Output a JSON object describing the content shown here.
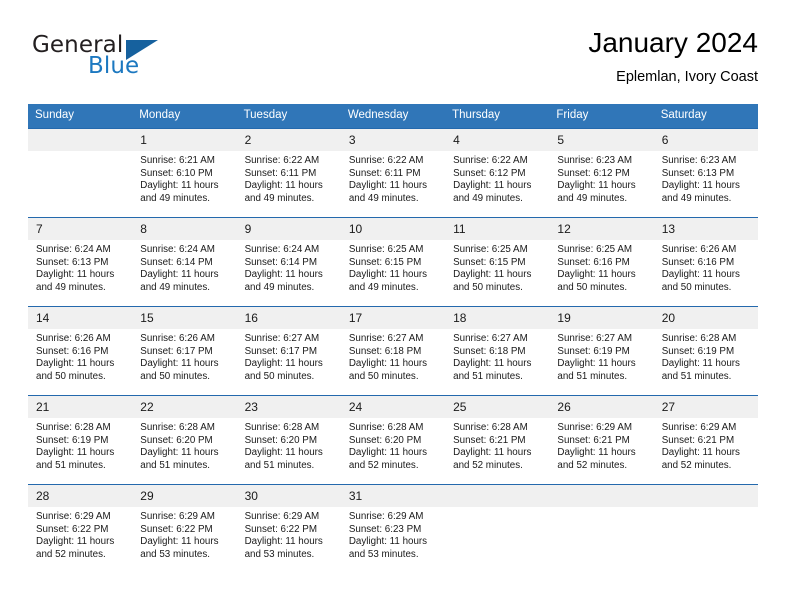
{
  "brand": {
    "name_top": "General",
    "name_bottom": "Blue",
    "accent_color": "#1c78c0",
    "triangle_color": "#16619e"
  },
  "header": {
    "title": "January 2024",
    "subtitle": "Eplemlan, Ivory Coast"
  },
  "theme": {
    "header_bg": "#3076b8",
    "separator": "#2469ad",
    "daynum_bg": "#f0f0f0",
    "text": "#1a1a1a"
  },
  "calendar": {
    "weekday_headers": [
      "Sunday",
      "Monday",
      "Tuesday",
      "Wednesday",
      "Thursday",
      "Friday",
      "Saturday"
    ],
    "weeks": [
      {
        "days": [
          {
            "num": "",
            "sunrise": "",
            "sunset": "",
            "daylight_1": "",
            "daylight_2": ""
          },
          {
            "num": "1",
            "sunrise": "Sunrise: 6:21 AM",
            "sunset": "Sunset: 6:10 PM",
            "daylight_1": "Daylight: 11 hours",
            "daylight_2": "and 49 minutes."
          },
          {
            "num": "2",
            "sunrise": "Sunrise: 6:22 AM",
            "sunset": "Sunset: 6:11 PM",
            "daylight_1": "Daylight: 11 hours",
            "daylight_2": "and 49 minutes."
          },
          {
            "num": "3",
            "sunrise": "Sunrise: 6:22 AM",
            "sunset": "Sunset: 6:11 PM",
            "daylight_1": "Daylight: 11 hours",
            "daylight_2": "and 49 minutes."
          },
          {
            "num": "4",
            "sunrise": "Sunrise: 6:22 AM",
            "sunset": "Sunset: 6:12 PM",
            "daylight_1": "Daylight: 11 hours",
            "daylight_2": "and 49 minutes."
          },
          {
            "num": "5",
            "sunrise": "Sunrise: 6:23 AM",
            "sunset": "Sunset: 6:12 PM",
            "daylight_1": "Daylight: 11 hours",
            "daylight_2": "and 49 minutes."
          },
          {
            "num": "6",
            "sunrise": "Sunrise: 6:23 AM",
            "sunset": "Sunset: 6:13 PM",
            "daylight_1": "Daylight: 11 hours",
            "daylight_2": "and 49 minutes."
          }
        ]
      },
      {
        "days": [
          {
            "num": "7",
            "sunrise": "Sunrise: 6:24 AM",
            "sunset": "Sunset: 6:13 PM",
            "daylight_1": "Daylight: 11 hours",
            "daylight_2": "and 49 minutes."
          },
          {
            "num": "8",
            "sunrise": "Sunrise: 6:24 AM",
            "sunset": "Sunset: 6:14 PM",
            "daylight_1": "Daylight: 11 hours",
            "daylight_2": "and 49 minutes."
          },
          {
            "num": "9",
            "sunrise": "Sunrise: 6:24 AM",
            "sunset": "Sunset: 6:14 PM",
            "daylight_1": "Daylight: 11 hours",
            "daylight_2": "and 49 minutes."
          },
          {
            "num": "10",
            "sunrise": "Sunrise: 6:25 AM",
            "sunset": "Sunset: 6:15 PM",
            "daylight_1": "Daylight: 11 hours",
            "daylight_2": "and 49 minutes."
          },
          {
            "num": "11",
            "sunrise": "Sunrise: 6:25 AM",
            "sunset": "Sunset: 6:15 PM",
            "daylight_1": "Daylight: 11 hours",
            "daylight_2": "and 50 minutes."
          },
          {
            "num": "12",
            "sunrise": "Sunrise: 6:25 AM",
            "sunset": "Sunset: 6:16 PM",
            "daylight_1": "Daylight: 11 hours",
            "daylight_2": "and 50 minutes."
          },
          {
            "num": "13",
            "sunrise": "Sunrise: 6:26 AM",
            "sunset": "Sunset: 6:16 PM",
            "daylight_1": "Daylight: 11 hours",
            "daylight_2": "and 50 minutes."
          }
        ]
      },
      {
        "days": [
          {
            "num": "14",
            "sunrise": "Sunrise: 6:26 AM",
            "sunset": "Sunset: 6:16 PM",
            "daylight_1": "Daylight: 11 hours",
            "daylight_2": "and 50 minutes."
          },
          {
            "num": "15",
            "sunrise": "Sunrise: 6:26 AM",
            "sunset": "Sunset: 6:17 PM",
            "daylight_1": "Daylight: 11 hours",
            "daylight_2": "and 50 minutes."
          },
          {
            "num": "16",
            "sunrise": "Sunrise: 6:27 AM",
            "sunset": "Sunset: 6:17 PM",
            "daylight_1": "Daylight: 11 hours",
            "daylight_2": "and 50 minutes."
          },
          {
            "num": "17",
            "sunrise": "Sunrise: 6:27 AM",
            "sunset": "Sunset: 6:18 PM",
            "daylight_1": "Daylight: 11 hours",
            "daylight_2": "and 50 minutes."
          },
          {
            "num": "18",
            "sunrise": "Sunrise: 6:27 AM",
            "sunset": "Sunset: 6:18 PM",
            "daylight_1": "Daylight: 11 hours",
            "daylight_2": "and 51 minutes."
          },
          {
            "num": "19",
            "sunrise": "Sunrise: 6:27 AM",
            "sunset": "Sunset: 6:19 PM",
            "daylight_1": "Daylight: 11 hours",
            "daylight_2": "and 51 minutes."
          },
          {
            "num": "20",
            "sunrise": "Sunrise: 6:28 AM",
            "sunset": "Sunset: 6:19 PM",
            "daylight_1": "Daylight: 11 hours",
            "daylight_2": "and 51 minutes."
          }
        ]
      },
      {
        "days": [
          {
            "num": "21",
            "sunrise": "Sunrise: 6:28 AM",
            "sunset": "Sunset: 6:19 PM",
            "daylight_1": "Daylight: 11 hours",
            "daylight_2": "and 51 minutes."
          },
          {
            "num": "22",
            "sunrise": "Sunrise: 6:28 AM",
            "sunset": "Sunset: 6:20 PM",
            "daylight_1": "Daylight: 11 hours",
            "daylight_2": "and 51 minutes."
          },
          {
            "num": "23",
            "sunrise": "Sunrise: 6:28 AM",
            "sunset": "Sunset: 6:20 PM",
            "daylight_1": "Daylight: 11 hours",
            "daylight_2": "and 51 minutes."
          },
          {
            "num": "24",
            "sunrise": "Sunrise: 6:28 AM",
            "sunset": "Sunset: 6:20 PM",
            "daylight_1": "Daylight: 11 hours",
            "daylight_2": "and 52 minutes."
          },
          {
            "num": "25",
            "sunrise": "Sunrise: 6:28 AM",
            "sunset": "Sunset: 6:21 PM",
            "daylight_1": "Daylight: 11 hours",
            "daylight_2": "and 52 minutes."
          },
          {
            "num": "26",
            "sunrise": "Sunrise: 6:29 AM",
            "sunset": "Sunset: 6:21 PM",
            "daylight_1": "Daylight: 11 hours",
            "daylight_2": "and 52 minutes."
          },
          {
            "num": "27",
            "sunrise": "Sunrise: 6:29 AM",
            "sunset": "Sunset: 6:21 PM",
            "daylight_1": "Daylight: 11 hours",
            "daylight_2": "and 52 minutes."
          }
        ]
      },
      {
        "days": [
          {
            "num": "28",
            "sunrise": "Sunrise: 6:29 AM",
            "sunset": "Sunset: 6:22 PM",
            "daylight_1": "Daylight: 11 hours",
            "daylight_2": "and 52 minutes."
          },
          {
            "num": "29",
            "sunrise": "Sunrise: 6:29 AM",
            "sunset": "Sunset: 6:22 PM",
            "daylight_1": "Daylight: 11 hours",
            "daylight_2": "and 53 minutes."
          },
          {
            "num": "30",
            "sunrise": "Sunrise: 6:29 AM",
            "sunset": "Sunset: 6:22 PM",
            "daylight_1": "Daylight: 11 hours",
            "daylight_2": "and 53 minutes."
          },
          {
            "num": "31",
            "sunrise": "Sunrise: 6:29 AM",
            "sunset": "Sunset: 6:23 PM",
            "daylight_1": "Daylight: 11 hours",
            "daylight_2": "and 53 minutes."
          },
          {
            "num": "",
            "sunrise": "",
            "sunset": "",
            "daylight_1": "",
            "daylight_2": ""
          },
          {
            "num": "",
            "sunrise": "",
            "sunset": "",
            "daylight_1": "",
            "daylight_2": ""
          },
          {
            "num": "",
            "sunrise": "",
            "sunset": "",
            "daylight_1": "",
            "daylight_2": ""
          }
        ]
      }
    ]
  }
}
